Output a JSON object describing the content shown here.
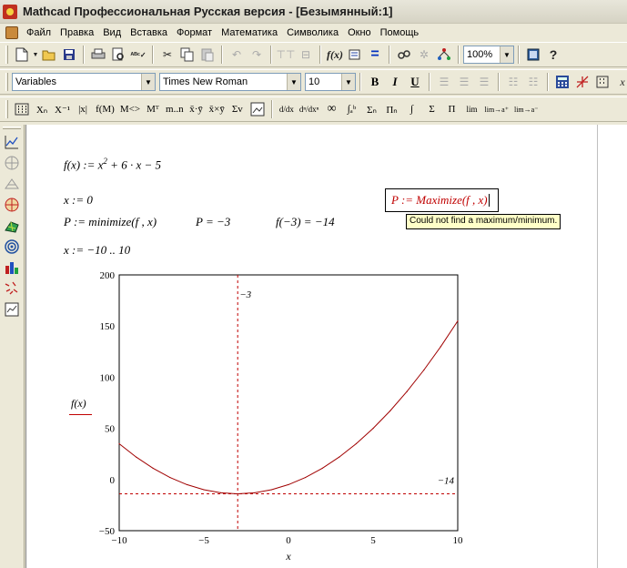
{
  "window": {
    "title": "Mathcad Профессиональная Русская версия - [Безымянный:1]"
  },
  "menu": {
    "items": [
      "Файл",
      "Правка",
      "Вид",
      "Вставка",
      "Формат",
      "Математика",
      "Символика",
      "Окно",
      "Помощь"
    ]
  },
  "toolbar": {
    "zoom": "100%"
  },
  "format_bar": {
    "style": "Variables",
    "font": "Times New Roman",
    "size": "10",
    "bold": "B",
    "italic": "I",
    "underline": "U"
  },
  "math_bar": {
    "buttons": [
      "Xₙ",
      "X⁻¹",
      "|x|",
      "f(M)",
      "M<>",
      "Mᵀ",
      "m..n",
      "x̄·ȳ",
      "x̄×ȳ",
      "Σv",
      "d/dx",
      "dⁿ/dxⁿ",
      "∞",
      "∫ₐᵇ",
      "Σₙ",
      "Πₙ",
      "∫",
      "Σ",
      "Π",
      "lim",
      "lim→a⁺",
      "lim→a⁻"
    ]
  },
  "worksheet": {
    "def": "f(x) := x",
    "def_exp": "2",
    "def_rest": " + 6 · x − 5",
    "x_assign": "x := 0",
    "minimize": "P := minimize(f , x)",
    "p_value": "P = −3",
    "f_value": "f(−3) = −14",
    "range": "x := −10 .. 10",
    "maximize_expr": "P := Maximize(f , x)",
    "error_tooltip": "Could not find a maximum/minimum."
  },
  "chart_data": {
    "type": "line",
    "function": "x^2 + 6x - 5",
    "x": [
      -10,
      -9,
      -8,
      -7,
      -6,
      -5,
      -4,
      -3,
      -2,
      -1,
      0,
      1,
      2,
      3,
      4,
      5,
      6,
      7,
      8,
      9,
      10
    ],
    "y": [
      35,
      22,
      11,
      2,
      -5,
      -10,
      -13,
      -14,
      -13,
      -10,
      -5,
      2,
      11,
      22,
      35,
      50,
      67,
      86,
      107,
      130,
      155
    ],
    "xlim": [
      -10,
      10
    ],
    "ylim": [
      -50,
      200
    ],
    "xticks": [
      "−10",
      "−5",
      "0",
      "5",
      "10"
    ],
    "yticks": [
      "200",
      "150",
      "100",
      "50",
      "0",
      "−50"
    ],
    "xlabel": "x",
    "ylabel": "f(x)",
    "markers": {
      "vertical": -3,
      "horizontal": -14,
      "vertical_label": "−3",
      "horizontal_label": "−14"
    },
    "grid": false,
    "colors": {
      "curve": "#a00000",
      "markers": "#c00000"
    }
  }
}
